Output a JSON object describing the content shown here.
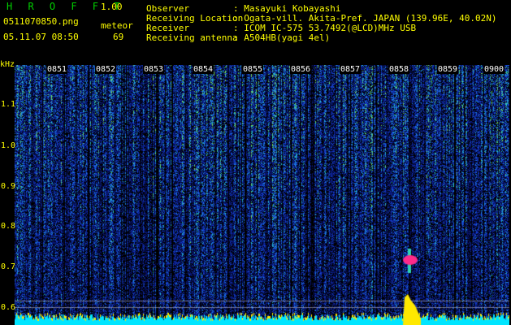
{
  "header": {
    "brand": "H R O F F T",
    "version": "1.00",
    "filename": "0511070850.png",
    "mode_label": "meteor",
    "datetime": "05.11.07 08:50",
    "count": "69",
    "fields": [
      {
        "label": "Observer",
        "value": ": Masayuki Kobayashi"
      },
      {
        "label": "Receiving Location",
        "value": ": Ogata-vill. Akita-Pref. JAPAN (139.96E, 40.02N)"
      },
      {
        "label": "Receiver",
        "value": ": ICOM IC-575 53.7492(@LCD)MHz USB"
      },
      {
        "label": "Receiving antenna",
        "value": ": A504HB(yagi 4el)"
      }
    ]
  },
  "axis": {
    "unit": "kHz",
    "y_ticks": [
      "1.1",
      "1.0",
      "0.9",
      "0.8",
      "0.7",
      "0.6"
    ],
    "time_ticks": [
      "0851",
      "0852",
      "0853",
      "0854",
      "0855",
      "0856",
      "0857",
      "0858",
      "0859",
      "0900"
    ]
  },
  "colors": {
    "background": "#000000",
    "noise_low": "#0a1a80",
    "noise_mid": "#1b5bd8",
    "noise_high": "#2fd3b0",
    "echo": "#ff2a8a",
    "baseline": "#00e5ff",
    "level": "#ffe800"
  }
}
